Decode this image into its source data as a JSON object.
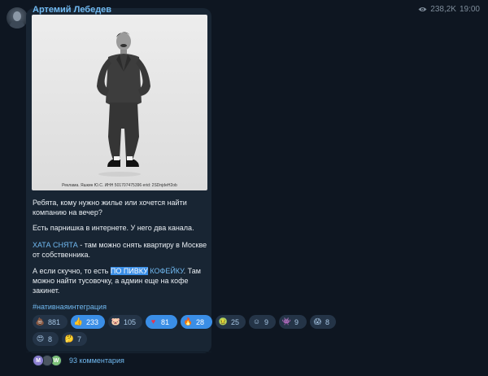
{
  "channel": {
    "name": "Артемий Лебедев",
    "views": "238,2K",
    "time": "19:00"
  },
  "post": {
    "photo_caption": "Реклама. Яшкин Ю.С. ИНН 501707475396 erid: 2SDnjdeH2ob",
    "paragraph1": "Ребята, кому нужно жилье или хочется найти компанию на вечер?",
    "paragraph2": "Есть парнишка в интернете. У него два канала.",
    "p3_link": "ХАТА СНЯТА",
    "p3_text": " - там можно снять квартиру в Москве от собственника.",
    "p4_text1": "А если скучно, то есть ",
    "p4_link_highlight": "ПО ПИВКУ",
    "p4_link_rest": " КОФЕЙКУ",
    "p4_text2": ". Там можно найти тусовочку, а админ еще на кофе закинет.",
    "hashtag": "#нативнаяинтеграция"
  },
  "reactions": [
    {
      "icon": "poop-emoji",
      "glyph": "💩",
      "count": "881",
      "active": false
    },
    {
      "icon": "thumbs-up-emoji",
      "glyph": "👍",
      "count": "233",
      "active": true
    },
    {
      "icon": "pig-emoji",
      "glyph": "🐷",
      "count": "105",
      "active": false
    },
    {
      "icon": "heart-emoji",
      "glyph": "♥",
      "count": "81",
      "active": true
    },
    {
      "icon": "fire-emoji",
      "glyph": "🔥",
      "count": "28",
      "active": true
    },
    {
      "icon": "nauseated-emoji",
      "glyph": "🤢",
      "count": "25",
      "active": false
    },
    {
      "icon": "slightly-smile-emoji",
      "glyph": "☺",
      "count": "9",
      "active": false
    },
    {
      "icon": "alien-emoji",
      "glyph": "👾",
      "count": "9",
      "active": false
    },
    {
      "icon": "scream-emoji",
      "glyph": "😱",
      "count": "8",
      "active": false
    },
    {
      "icon": "heart-eyes-emoji",
      "glyph": "😍",
      "count": "8",
      "active": false
    },
    {
      "icon": "thinking-emoji",
      "glyph": "🤔",
      "count": "7",
      "active": false
    }
  ],
  "comments": {
    "label": "93 комментария",
    "avatars": [
      {
        "letter": "M",
        "color": "#8b7fd0"
      },
      {
        "letter": "",
        "color": "#4a5560"
      },
      {
        "letter": "W",
        "color": "#7ec27a"
      }
    ]
  },
  "colors": {
    "background": "#0e1621",
    "bubble": "#182533",
    "accent": "#71baf2",
    "reaction_active": "#3a8ee6",
    "reaction_inactive": "#243447"
  }
}
